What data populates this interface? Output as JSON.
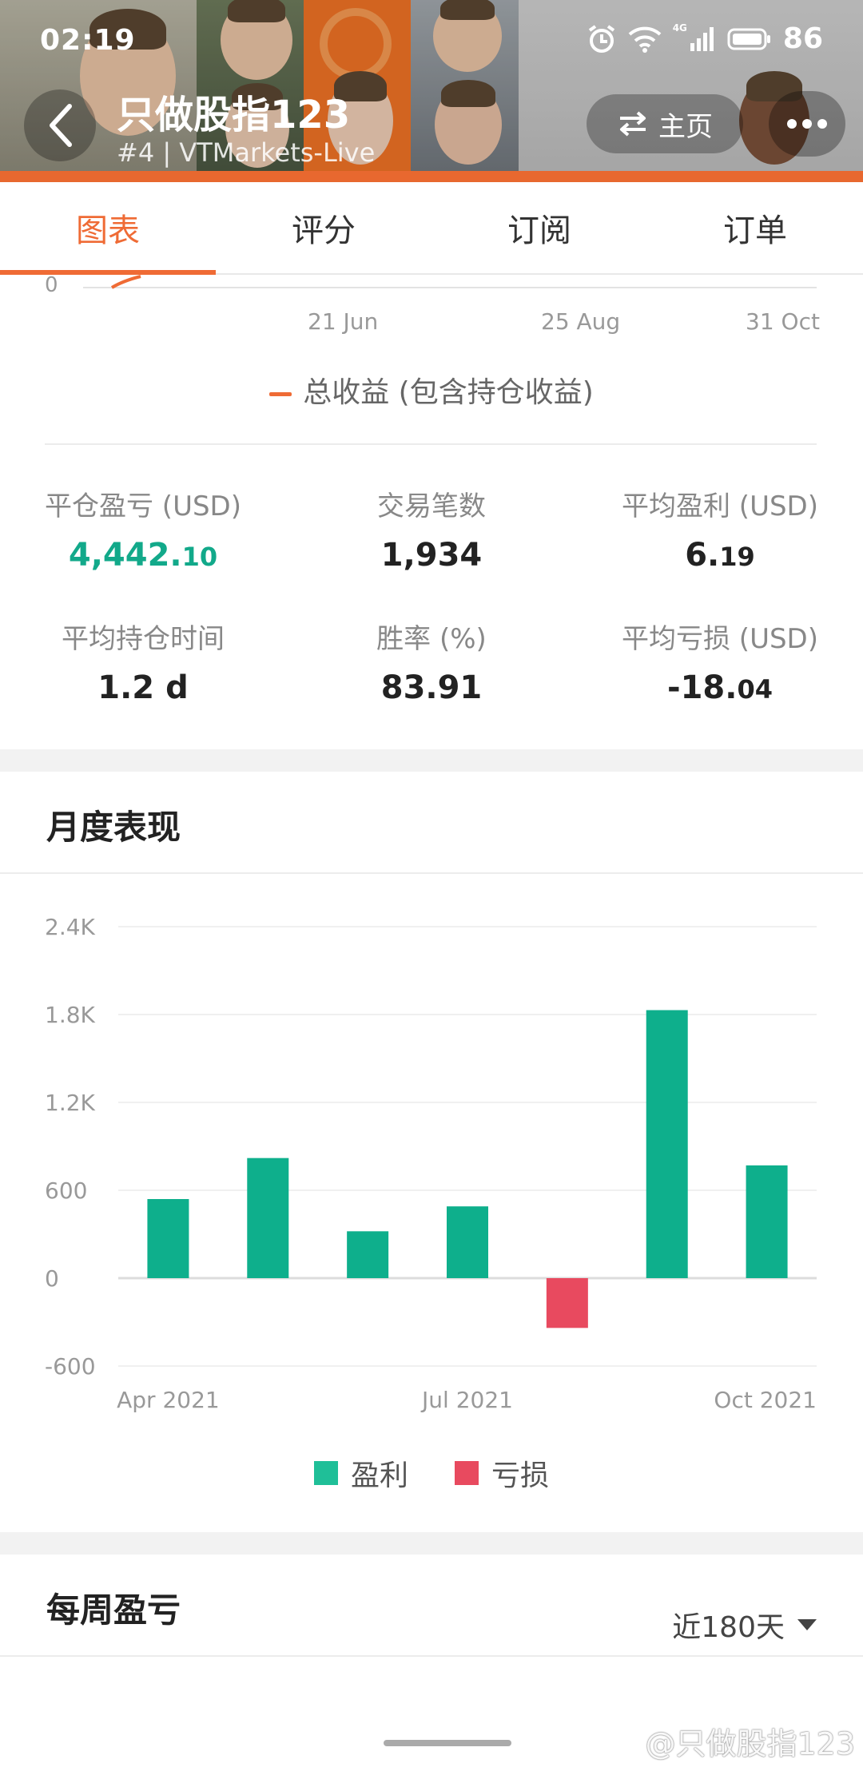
{
  "status_bar": {
    "time": "02:19",
    "network_label": "4G",
    "battery": "86"
  },
  "header": {
    "title": "只做股指123",
    "subtitle": "#4  |  VTMarkets-Live",
    "home_label": "主页",
    "accent_color": "#e8682f"
  },
  "tabs": [
    {
      "label": "图表",
      "active": true
    },
    {
      "label": "评分",
      "active": false
    },
    {
      "label": "订阅",
      "active": false
    },
    {
      "label": "订单",
      "active": false
    }
  ],
  "equity_chart": {
    "y_visible_tick": "0",
    "x_ticks": [
      "21 Jun",
      "25 Aug",
      "31 Oct"
    ],
    "legend": "总收益 (包含持仓收益)",
    "line_color": "#ef6b35"
  },
  "stats": [
    {
      "label": "平仓盈亏 (USD)",
      "int": "4,442.",
      "dec": "10",
      "color": "#12a98a"
    },
    {
      "label": "交易笔数",
      "int": "1,934",
      "dec": ""
    },
    {
      "label": "平均盈利 (USD)",
      "int": "6.",
      "dec": "19"
    },
    {
      "label": "平均持仓时间",
      "int": "1.2 d",
      "dec": ""
    },
    {
      "label": "胜率 (%)",
      "int": "83.91",
      "dec": ""
    },
    {
      "label": "平均亏损 (USD)",
      "int": "-18.",
      "dec": "04"
    }
  ],
  "monthly": {
    "title": "月度表现",
    "legend_profit": "盈利",
    "legend_loss": "亏损"
  },
  "weekly": {
    "title": "每周盈亏",
    "range_label": "近180天"
  },
  "watermark": "@只做股指123",
  "chart_data": {
    "type": "bar",
    "categories": [
      "Apr 2021",
      "May 2021",
      "Jun 2021",
      "Jul 2021",
      "Aug 2021",
      "Sep 2021",
      "Oct 2021"
    ],
    "x_tick_labels": [
      "Apr 2021",
      "Jul 2021",
      "Oct 2021"
    ],
    "values": [
      540,
      820,
      320,
      490,
      -340,
      1830,
      770
    ],
    "series": [
      {
        "name": "盈利",
        "color": "#0eaf8c"
      },
      {
        "name": "亏损",
        "color": "#e84a5f"
      }
    ],
    "y_ticks": [
      "2.4K",
      "1.8K",
      "1.2K",
      "600",
      "0",
      "-600"
    ],
    "ylim": [
      -600,
      2400
    ],
    "grid": true,
    "legend_position": "bottom"
  }
}
